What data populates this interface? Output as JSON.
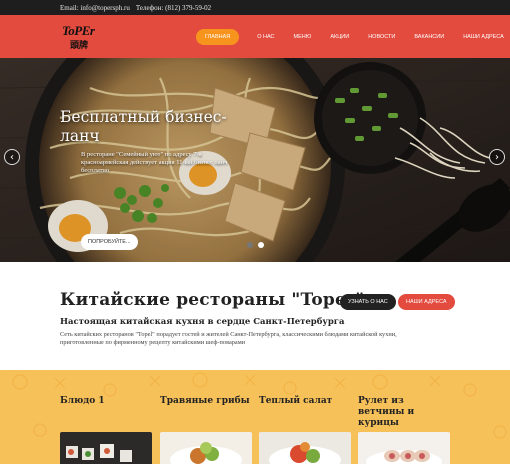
{
  "topbar": {
    "email": "Email: info@topersph.ru",
    "phone": "Телефон: (812) 379-59-02"
  },
  "brand": {
    "logo_latin": "ToPEr",
    "logo_cjk": "頭牌"
  },
  "nav": {
    "items": [
      "Главная",
      "О нас",
      "Меню",
      "Акции",
      "Новости",
      "Вакансии",
      "Наши адреса"
    ],
    "active_index": 0
  },
  "hero": {
    "title": "Бесплатный бизнес-ланч",
    "description": "В ресторане \"Семейный уют\" по адресу 7-я красноармейская действует акция 11-ый бизнес ланч бесплатно",
    "button": "ПОПРОБУЙТЕ...",
    "prev_icon": "chevron-left-icon",
    "next_icon": "chevron-right-icon",
    "slides_count": 2,
    "active_slide": 2
  },
  "about": {
    "title": "Китайские рестораны \"Toper\"",
    "subtitle": "Настоящая китайская кухня в сердце Санкт-Петербурга",
    "text": "Сеть китайских ресторанов \"Topel\" порадует гостей и жителей Санкт-Петербурга, классическими блюдами китайской кухни, приготовленные по фирменному рецепту китайскими шеф-поварами",
    "btn_more": "УЗНАТЬ О НАС",
    "btn_addresses": "НАШИ АДРЕСА"
  },
  "menu": {
    "cards": [
      {
        "title": "Блюдо 1"
      },
      {
        "title": "Травяные грибы"
      },
      {
        "title": "Теплый салат"
      },
      {
        "title": "Рулет из ветчины и курицы"
      }
    ]
  },
  "colors": {
    "accent_red": "#e34b3f",
    "accent_orange": "#f7941d",
    "menu_bg": "#f7c15a",
    "topbar_bg": "#1e1e1e"
  }
}
